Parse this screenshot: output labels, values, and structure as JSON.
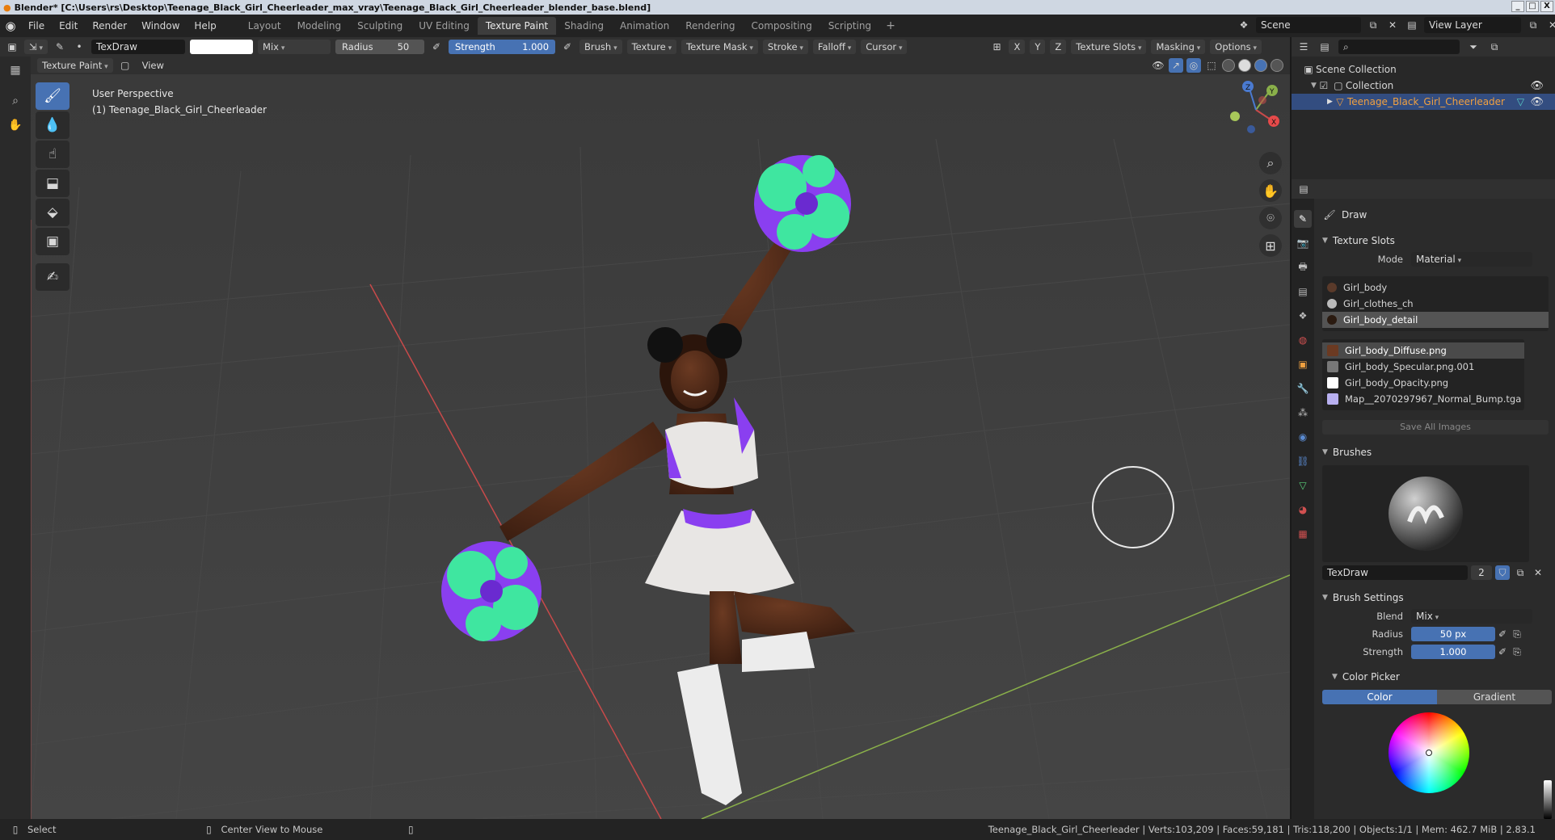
{
  "title": "Blender* [C:\\Users\\rs\\Desktop\\Teenage_Black_Girl_Cheerleader_max_vray\\Teenage_Black_Girl_Cheerleader_blender_base.blend]",
  "window_controls": [
    "_",
    "□",
    "X"
  ],
  "menu": [
    "File",
    "Edit",
    "Render",
    "Window",
    "Help"
  ],
  "workspaces": [
    "Layout",
    "Modeling",
    "Sculpting",
    "UV Editing",
    "Texture Paint",
    "Shading",
    "Animation",
    "Rendering",
    "Compositing",
    "Scripting"
  ],
  "active_workspace": "Texture Paint",
  "scene": {
    "name": "Scene",
    "view_layer": "View Layer"
  },
  "tool_header": {
    "brush_name": "TexDraw",
    "blend": "Mix",
    "radius_label": "Radius",
    "radius_value": "50 px",
    "strength_label": "Strength",
    "strength_value": "1.000",
    "menus": [
      "Brush",
      "Texture",
      "Texture Mask",
      "Stroke",
      "Falloff",
      "Cursor"
    ],
    "axes": [
      "X",
      "Y",
      "Z"
    ],
    "right_menus": [
      "Texture Slots",
      "Masking",
      "Options"
    ]
  },
  "viewport_header": {
    "mode": "Texture Paint",
    "view": "View"
  },
  "viewport": {
    "perspective": "User Perspective",
    "object_label": "(1) Teenage_Black_Girl_Cheerleader"
  },
  "gizmo": {
    "x": "X",
    "y": "Y",
    "z": "Z"
  },
  "outliner": {
    "scene_collection": "Scene Collection",
    "collection": "Collection",
    "object": "Teenage_Black_Girl_Cheerleader"
  },
  "properties": {
    "tool_name": "Draw",
    "texture_slots": {
      "header": "Texture Slots",
      "mode_label": "Mode",
      "mode_value": "Material",
      "materials": [
        "Girl_body",
        "Girl_clothes_ch",
        "Girl_body_detail"
      ],
      "selected_material": "Girl_body_detail",
      "images": [
        "Girl_body_Diffuse.png",
        "Girl_body_Specular.png.001",
        "Girl_body_Opacity.png",
        "Map__2070297967_Normal_Bump.tga"
      ],
      "selected_image": "Girl_body_Diffuse.png",
      "save_all": "Save All Images"
    },
    "brushes": {
      "header": "Brushes",
      "brush_name": "TexDraw",
      "users": "2"
    },
    "brush_settings": {
      "header": "Brush Settings",
      "blend_label": "Blend",
      "blend_value": "Mix",
      "radius_label": "Radius",
      "radius_value": "50 px",
      "strength_label": "Strength",
      "strength_value": "1.000"
    },
    "color_picker": {
      "header": "Color Picker",
      "tab_color": "Color",
      "tab_gradient": "Gradient"
    }
  },
  "statusbar": {
    "select": "Select",
    "center": "Center View to Mouse",
    "stats": "Teenage_Black_Girl_Cheerleader | Verts:103,209 | Faces:59,181 | Tris:118,200 | Objects:1/1 | Mem: 462.7 MiB | 2.83.1"
  },
  "colors": {
    "accent_blue": "#4772b3",
    "pompom_purple": "#8a3ff0",
    "pompom_green": "#3fe6a0",
    "grid_red": "#c84a4a",
    "grid_green": "#8ab04a"
  }
}
